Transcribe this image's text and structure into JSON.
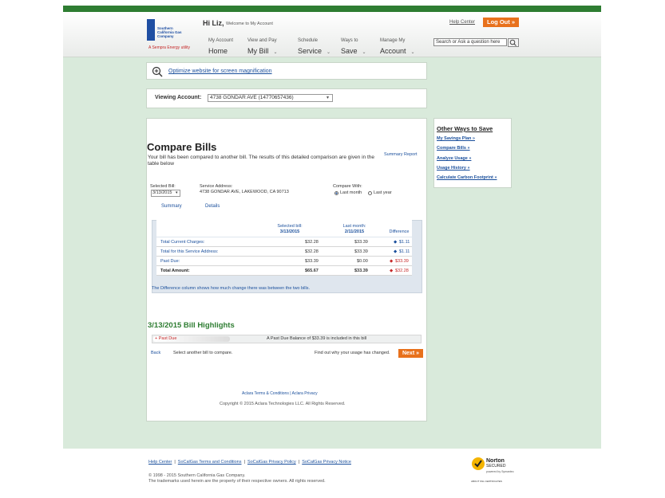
{
  "header": {
    "logo_text": "Southern California Gas Company",
    "sempra_text": "A Sempra Energy utility",
    "greeting_name": "Hi Liz,",
    "greeting_sub": "Welcome to My Account",
    "help_center": "Help Center",
    "logout": "Log Out »",
    "search_placeholder": "Search or Ask a question here",
    "nav": [
      {
        "small": "My Account",
        "big": "Home"
      },
      {
        "small": "View and Pay",
        "big": "My Bill"
      },
      {
        "small": "Schedule",
        "big": "Service"
      },
      {
        "small": "Ways to",
        "big": "Save"
      },
      {
        "small": "Manage My",
        "big": "Account"
      }
    ]
  },
  "optimize": {
    "link": "Optimize website for screen magnification"
  },
  "viewing": {
    "label": "Viewing Account:",
    "value": "4738 GONDAR AVE (14770657436)"
  },
  "compare": {
    "title": "Compare Bills",
    "description": "Your bill has been compared to another bill. The results of this detailed comparison are given in the table below",
    "summary_report": "Summary Report",
    "selected_bill_label": "Selected Bill:",
    "selected_bill_value": "3/13/2015",
    "service_address_label": "Service Address:",
    "service_address_value": "4738 GONDAR AVE, LAKEWOOD, CA 90713",
    "compare_with_label": "Compare With:",
    "option_last_month": "Last month",
    "option_last_year": "Last year",
    "tab_summary": "Summary",
    "tab_details": "Details",
    "table": {
      "headers": [
        {
          "line1": "Selected bill:",
          "line2": "3/13/2015"
        },
        {
          "line1": "Last month:",
          "line2": "2/11/2015"
        },
        {
          "line1": "Difference",
          "line2": ""
        }
      ],
      "rows": [
        {
          "label": "Total Current Charges:",
          "selected": "$32.28",
          "last": "$33.39",
          "diff": "$1.11",
          "dir": "down"
        },
        {
          "label": "Total for this Service Address:",
          "selected": "$32.28",
          "last": "$33.39",
          "diff": "$1.11",
          "dir": "down"
        },
        {
          "label": "Past Due:",
          "selected": "$33.39",
          "last": "$0.00",
          "diff": "$33.39",
          "dir": "up"
        },
        {
          "label": "Total Amount:",
          "selected": "$65.67",
          "last": "$33.39",
          "diff": "$32.28",
          "dir": "up"
        }
      ]
    },
    "difference_note": "The Difference column shows how much change there was between the two bills."
  },
  "highlights": {
    "title": "3/13/2015 Bill Highlights",
    "item_label": "Past Due",
    "item_text": "A Past Due Balance of $33.39 is included in this bill"
  },
  "actions": {
    "back": "Back",
    "select_another": "Select another bill to compare.",
    "find_out": "Find out why your usage has changed.",
    "next": "Next »"
  },
  "aclara": {
    "terms": "Aclara Terms & Conditions",
    "separator": "|",
    "privacy": "Aclara Privacy",
    "copyright": "Copyright © 2015 Aclara Technologies LLC. All Rights Reserved."
  },
  "ways": {
    "title": "Other Ways to Save",
    "links": [
      "My Savings Plan »",
      "Compare Bills »",
      "Analyze Usage »",
      "Usage History »",
      "Calculate Carbon Footprint »"
    ]
  },
  "footer": {
    "links": [
      "Help Center",
      "SoCalGas Terms and Conditions",
      "SoCalGas Privacy Policy",
      "SoCalGas Privacy Notice"
    ],
    "separator": "|",
    "copy1": "© 1998 - 2015 Southern California Gas Company.",
    "copy2": "The trademarks used herein are the property of their respective owners. All rights reserved.",
    "norton_title": "Norton",
    "norton_secured": "SECURED",
    "norton_powered": "powered by Symantec",
    "norton_about": "ABOUT SSL CERTIFICATES"
  },
  "colors": {
    "brand_green": "#2e7d32",
    "accent_orange": "#e8711c",
    "link_blue": "#1a4f9c",
    "bg_green": "#d9eadb"
  }
}
